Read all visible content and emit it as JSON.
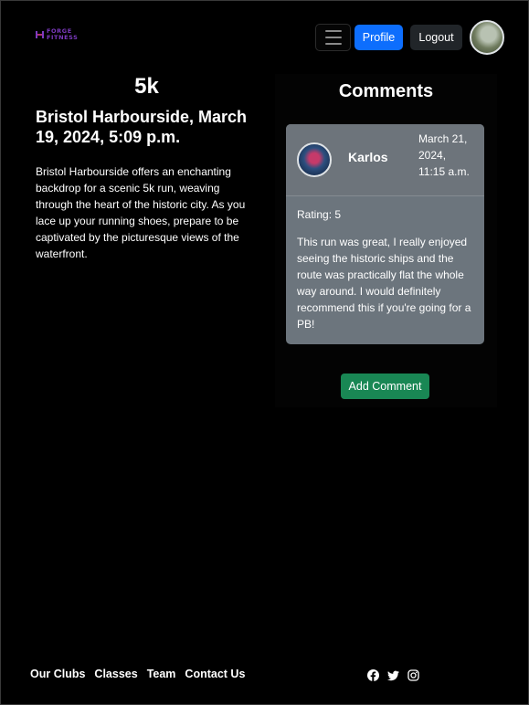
{
  "brand": {
    "line1": "FORGE",
    "line2": "FITNESS",
    "accent": "#7d3ac1"
  },
  "nav": {
    "menu_icon": "hamburger-icon",
    "profile_label": "Profile",
    "logout_label": "Logout",
    "avatar_icon": "user-avatar"
  },
  "event": {
    "title": "5k",
    "subtitle": "Bristol Harbourside, March 19, 2024, 5:09 p.m.",
    "description": "Bristol Harbourside offers an enchanting backdrop for a scenic 5k run, weaving through the heart of the historic city. As you lace up your running shoes, prepare to be captivated by the picturesque views of the waterfront."
  },
  "comments": {
    "heading": "Comments",
    "items": [
      {
        "author": "Karlos",
        "date": "March 21, 2024, 11:15 a.m.",
        "rating": "Rating: 5",
        "text": "This run was great, I really enjoyed seeing the historic ships and the route was practically flat the whole way around. I would definitely recommend this if you're going for a PB!"
      }
    ],
    "add_label": "Add Comment"
  },
  "footer": {
    "links": [
      "Our Clubs",
      "Classes",
      "Team",
      "Contact Us"
    ],
    "social_icons": [
      "facebook-icon",
      "twitter-icon",
      "instagram-icon"
    ]
  },
  "colors": {
    "profile_button": "#0d6efd",
    "logout_button": "#212529",
    "card_bg": "#6c757d",
    "add_button": "#198754"
  }
}
